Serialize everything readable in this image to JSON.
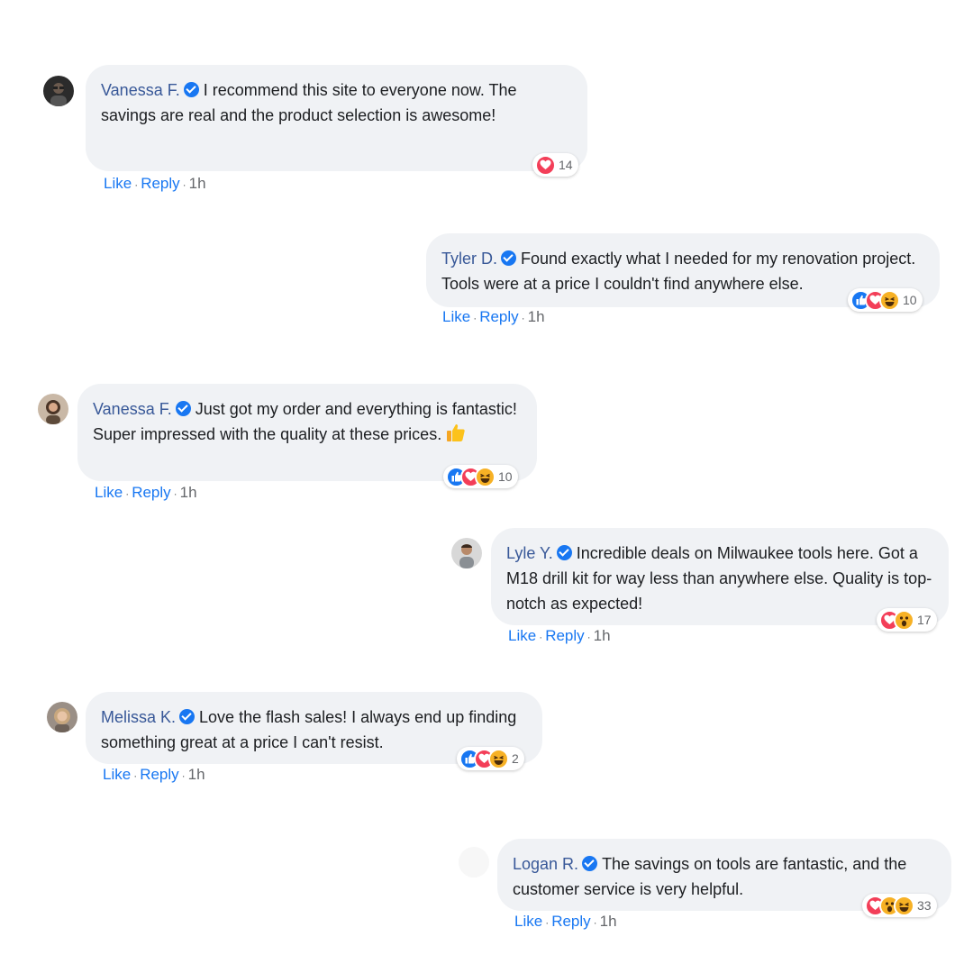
{
  "comments": [
    {
      "name": "Vanessa F.",
      "text": "I recommend this site to everyone now. The savings are real and the product selection is awesome!",
      "reactions": [
        "love"
      ],
      "reaction_count": "14",
      "actions": {
        "like": "Like",
        "reply": "Reply",
        "time": "1h"
      }
    },
    {
      "name": "Tyler D.",
      "text": "Found exactly what I needed for my renovation project. Tools were at a price I couldn't find anywhere else.",
      "reactions": [
        "like",
        "love",
        "haha"
      ],
      "reaction_count": "10",
      "actions": {
        "like": "Like",
        "reply": "Reply",
        "time": "1h"
      }
    },
    {
      "name": "Vanessa F.",
      "text": "Just got my order and everything is fantastic! Super impressed with the quality at these prices.",
      "emoji": "thumbs-up",
      "reactions": [
        "like",
        "love",
        "haha"
      ],
      "reaction_count": "10",
      "actions": {
        "like": "Like",
        "reply": "Reply",
        "time": "1h"
      }
    },
    {
      "name": "Lyle Y.",
      "text": "Incredible deals on Milwaukee tools here. Got a M18 drill kit for way less than anywhere else. Quality is top-notch as expected!",
      "reactions": [
        "love",
        "wow"
      ],
      "reaction_count": "17",
      "actions": {
        "like": "Like",
        "reply": "Reply",
        "time": "1h"
      }
    },
    {
      "name": "Melissa K.",
      "text": "Love the flash sales! I always end up finding something great at a price I can't resist.",
      "reactions": [
        "like",
        "love",
        "haha"
      ],
      "reaction_count": "2",
      "actions": {
        "like": "Like",
        "reply": "Reply",
        "time": "1h"
      }
    },
    {
      "name": "Logan R.",
      "text": "The savings on tools are fantastic, and the customer service is very helpful.",
      "reactions": [
        "love",
        "wow",
        "haha"
      ],
      "reaction_count": "33",
      "actions": {
        "like": "Like",
        "reply": "Reply",
        "time": "1h"
      }
    }
  ],
  "colors": {
    "bubble_bg": "#f0f2f5",
    "name": "#385898",
    "link": "#1877f2",
    "meta": "#65676b",
    "like": "#1877f2",
    "love": "#f33e58",
    "haha": "#f7b125"
  },
  "icons": {
    "verified": "verified-badge-icon",
    "like": "like-reaction-icon",
    "love": "love-reaction-icon",
    "haha": "haha-reaction-icon",
    "wow": "wow-reaction-icon",
    "thumbs_up": "thumbs-up-emoji-icon"
  }
}
